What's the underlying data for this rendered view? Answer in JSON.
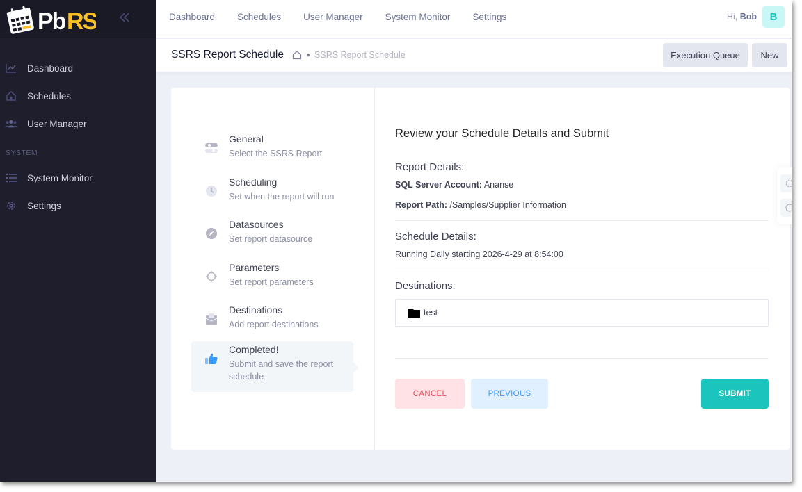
{
  "brand": {
    "name": "PbRS"
  },
  "sidebar": {
    "items": [
      {
        "label": "Dashboard",
        "icon": "chart-line-icon"
      },
      {
        "label": "Schedules",
        "icon": "home-icon"
      },
      {
        "label": "User Manager",
        "icon": "users-icon"
      }
    ],
    "section_label": "SYSTEM",
    "system_items": [
      {
        "label": "System Monitor",
        "icon": "list-icon"
      },
      {
        "label": "Settings",
        "icon": "gear-icon"
      }
    ]
  },
  "topnav": {
    "items": [
      "Dashboard",
      "Schedules",
      "User Manager",
      "System Monitor",
      "Settings"
    ],
    "greeting": "Hi,",
    "user": "Bob",
    "avatar_letter": "B"
  },
  "subheader": {
    "title": "SSRS Report Schedule",
    "breadcrumb": "SSRS Report Schedule",
    "execution_queue_label": "Execution Queue",
    "new_label": "New"
  },
  "wizard": {
    "steps": [
      {
        "title": "General",
        "desc": "Select the SSRS Report",
        "icon": "toggle-icon"
      },
      {
        "title": "Scheduling",
        "desc": "Set when the report will run",
        "icon": "clock-icon"
      },
      {
        "title": "Datasources",
        "desc": "Set report datasource",
        "icon": "compass-icon"
      },
      {
        "title": "Parameters",
        "desc": "Set report parameters",
        "icon": "target-icon"
      },
      {
        "title": "Destinations",
        "desc": "Add report destinations",
        "icon": "mailbox-icon"
      },
      {
        "title": "Completed!",
        "desc": "Submit and save the report schedule",
        "icon": "thumbs-up-icon",
        "active": true
      }
    ]
  },
  "review": {
    "heading": "Review your Schedule Details and Submit",
    "report_details_title": "Report Details:",
    "sql_account_label": "SQL Server Account:",
    "sql_account_value": "Ananse",
    "report_path_label": "Report Path:",
    "report_path_value": "/Samples/Supplier Information",
    "schedule_details_title": "Schedule Details:",
    "schedule_text": "Running Daily starting 2026-4-29 at 8:54:00",
    "destinations_title": "Destinations:",
    "destinations": [
      {
        "name": "test",
        "icon": "folder-icon"
      }
    ]
  },
  "actions": {
    "cancel": "CANCEL",
    "previous": "PREVIOUS",
    "submit": "SUBMIT"
  },
  "colors": {
    "sidebar_bg": "#1e1e2d",
    "accent_teal": "#1bc5bd",
    "danger_light": "#ffe2e5",
    "primary_light": "#e1f0ff"
  }
}
